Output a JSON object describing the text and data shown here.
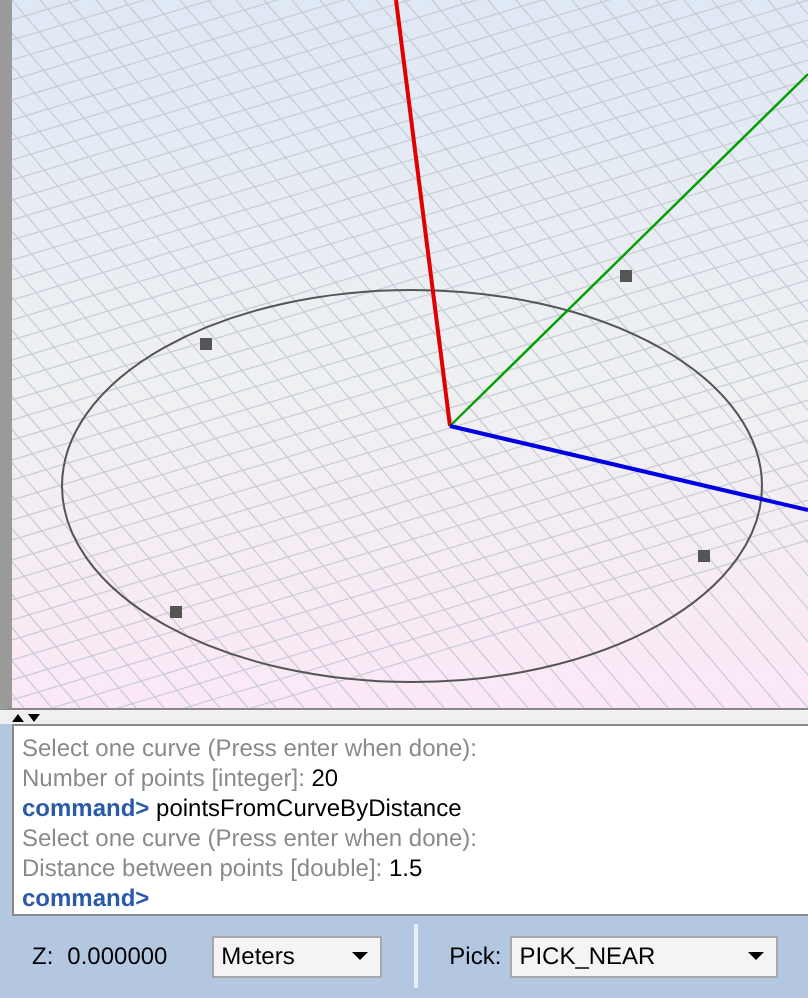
{
  "console": {
    "lines": [
      {
        "kind": "output",
        "text": "Select one curve (Press enter when done):"
      },
      {
        "kind": "query",
        "text": "Number of points [integer]:",
        "value": "20"
      },
      {
        "kind": "command",
        "text": "command>",
        "value": "pointsFromCurveByDistance"
      },
      {
        "kind": "output",
        "text": "Select one curve (Press enter when done):"
      },
      {
        "kind": "query",
        "text": "Distance between points [double]:",
        "value": "1.5"
      },
      {
        "kind": "command",
        "text": "command>"
      }
    ]
  },
  "status_bar": {
    "z_label": "Z:",
    "z_value": "0.000000",
    "units": "Meters",
    "pick_label": "Pick:",
    "pick_mode": "PICK_NEAR"
  }
}
